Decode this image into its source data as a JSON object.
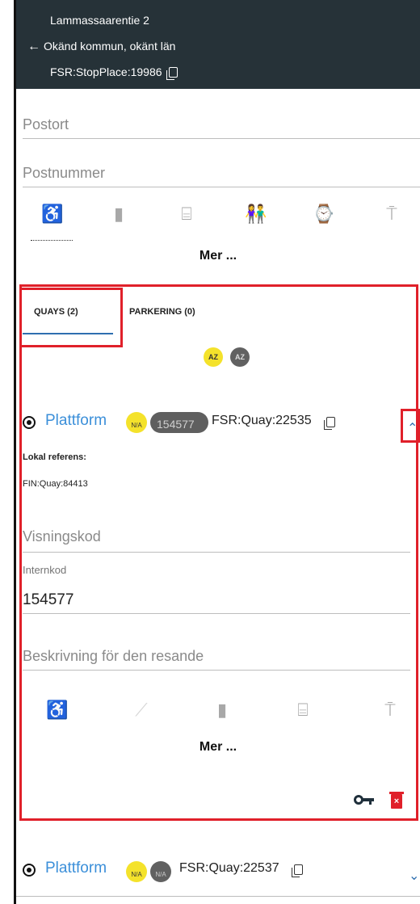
{
  "header": {
    "title": "Lammassaarentie 2",
    "location": "Okänd kommun, okänt län",
    "stop_id": "FSR:StopPlace:19986",
    "back_icon": "arrow-left-icon",
    "copy_icon": "copy-icon"
  },
  "fields": {
    "postort_placeholder": "Postort",
    "postnummer_placeholder": "Postnummer"
  },
  "stop_facilities": {
    "icons": [
      "wheelchair-icon",
      "ticket-machine-icon",
      "shelter-icon",
      "toilets-icon",
      "waiting-room-icon",
      "signpost-icon"
    ],
    "more_label": "Mer ..."
  },
  "tabs": [
    {
      "label": "QUAYS (2)",
      "active": true
    },
    {
      "label": "PARKERING (0)",
      "active": false
    }
  ],
  "sort": {
    "asc_label": "AZ",
    "desc_label": "AZ"
  },
  "quays": [
    {
      "name": "Plattform",
      "na_label": "N/A",
      "code_badge": "154577",
      "id": "FSR:Quay:22535",
      "expanded": true,
      "local_ref_label": "Lokal referens:",
      "local_ref_value": "FIN:Quay:84413",
      "visningskod_placeholder": "Visningskod",
      "internkod_label": "Internkod",
      "internkod_value": "154577",
      "description_placeholder": "Beskrivning för den resande",
      "facility_icons": [
        "wheelchair-icon",
        "step-free-icon",
        "ticket-machine-icon",
        "shelter-icon",
        "signpost-icon"
      ],
      "more_label": "Mer ..."
    },
    {
      "name": "Plattform",
      "na_label": "N/A",
      "code_badge": "N/A",
      "id": "FSR:Quay:22537",
      "expanded": false
    }
  ],
  "colors": {
    "header_bg": "#263238",
    "link_blue": "#3b8fd9",
    "annotation_red": "#e0202a",
    "badge_yellow": "#f4e22b"
  }
}
